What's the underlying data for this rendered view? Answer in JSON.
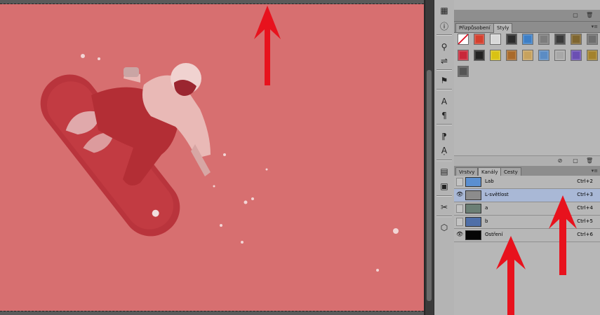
{
  "canvas": {
    "image_description_icon": "snowboarder-photo",
    "overlay_color": "#d76f70"
  },
  "dock": {
    "icons": [
      "3d-panel-icon",
      "info-icon",
      "brush-presets-icon",
      "mixer-icon",
      "clone-source-icon",
      "character-icon",
      "paragraph-icon",
      "character-styles-icon",
      "paragraph-styles-icon",
      "layer-comps-icon",
      "notes-icon",
      "tool-presets-icon",
      "3d-material-icon"
    ]
  },
  "styles_panel": {
    "tabs": [
      {
        "label": "Přizpůsobení",
        "active": false
      },
      {
        "label": "Styly",
        "active": true
      }
    ],
    "swatch_colors": [
      "none",
      "#d4402e",
      "#d8d8d8",
      "#2b2b2b",
      "#3e7fc6",
      "#7d7d7d",
      "#3a3a3a",
      "#7f6630",
      "#6e6e6e",
      "#5b6a7e",
      "#c8283a",
      "#222222",
      "#d9c213",
      "#a96a2a",
      "#c7a25e",
      "#5b8cc4",
      "#a8a8a8",
      "#6b4fb3",
      "#a3822c",
      "#c9c9c9",
      "#555555"
    ]
  },
  "channels_panel": {
    "tabs": [
      {
        "label": "Vrstvy",
        "active": false
      },
      {
        "label": "Kanály",
        "active": true
      },
      {
        "label": "Cesty",
        "active": false
      }
    ],
    "rows": [
      {
        "name": "Lab",
        "shortcut": "Ctrl+2",
        "visible": false,
        "selected": false,
        "thumb_color": "#5b8fd0"
      },
      {
        "name": "L-světlost",
        "shortcut": "Ctrl+3",
        "visible": true,
        "selected": true,
        "thumb_color": "#8c8c8c"
      },
      {
        "name": "a",
        "shortcut": "Ctrl+4",
        "visible": false,
        "selected": false,
        "thumb_color": "#6b7f75"
      },
      {
        "name": "b",
        "shortcut": "Ctrl+5",
        "visible": false,
        "selected": false,
        "thumb_color": "#4f6fa8"
      },
      {
        "name": "Ostření",
        "shortcut": "Ctrl+6",
        "visible": true,
        "selected": false,
        "thumb_color": "#050505"
      }
    ]
  },
  "annotation_color": "#e8121d"
}
